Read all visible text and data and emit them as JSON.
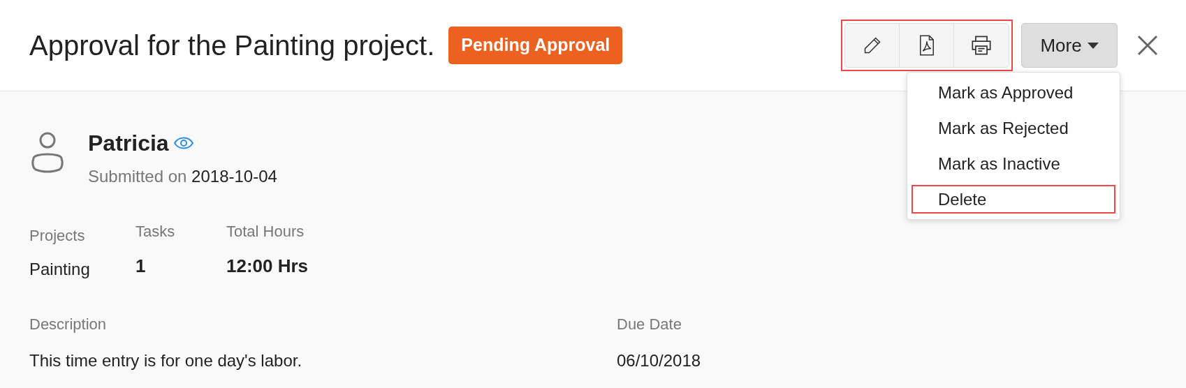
{
  "header": {
    "title": "Approval for the Painting project.",
    "status": "Pending Approval"
  },
  "toolbar": {
    "highlighted": true
  },
  "more_button": {
    "label": "More",
    "expanded": true
  },
  "menu": [
    {
      "label": "Mark as Approved",
      "highlighted": false
    },
    {
      "label": "Mark as Rejected",
      "highlighted": false
    },
    {
      "label": "Mark as Inactive",
      "highlighted": false
    },
    {
      "label": "Delete",
      "highlighted": true
    }
  ],
  "submitter": {
    "name": "Patricia",
    "submitted_label": "Submitted on",
    "submitted_date": "2018-10-04"
  },
  "summary": [
    {
      "label": "Projects",
      "value": "Painting",
      "bold": false
    },
    {
      "label": "Tasks",
      "value": "1",
      "bold": true
    },
    {
      "label": "Total Hours",
      "value": "12:00 Hrs",
      "bold": true
    }
  ],
  "details": [
    {
      "label": "Description",
      "value": "This time entry is for one day's labor."
    },
    {
      "label": "Due Date",
      "value": "06/10/2018"
    }
  ]
}
